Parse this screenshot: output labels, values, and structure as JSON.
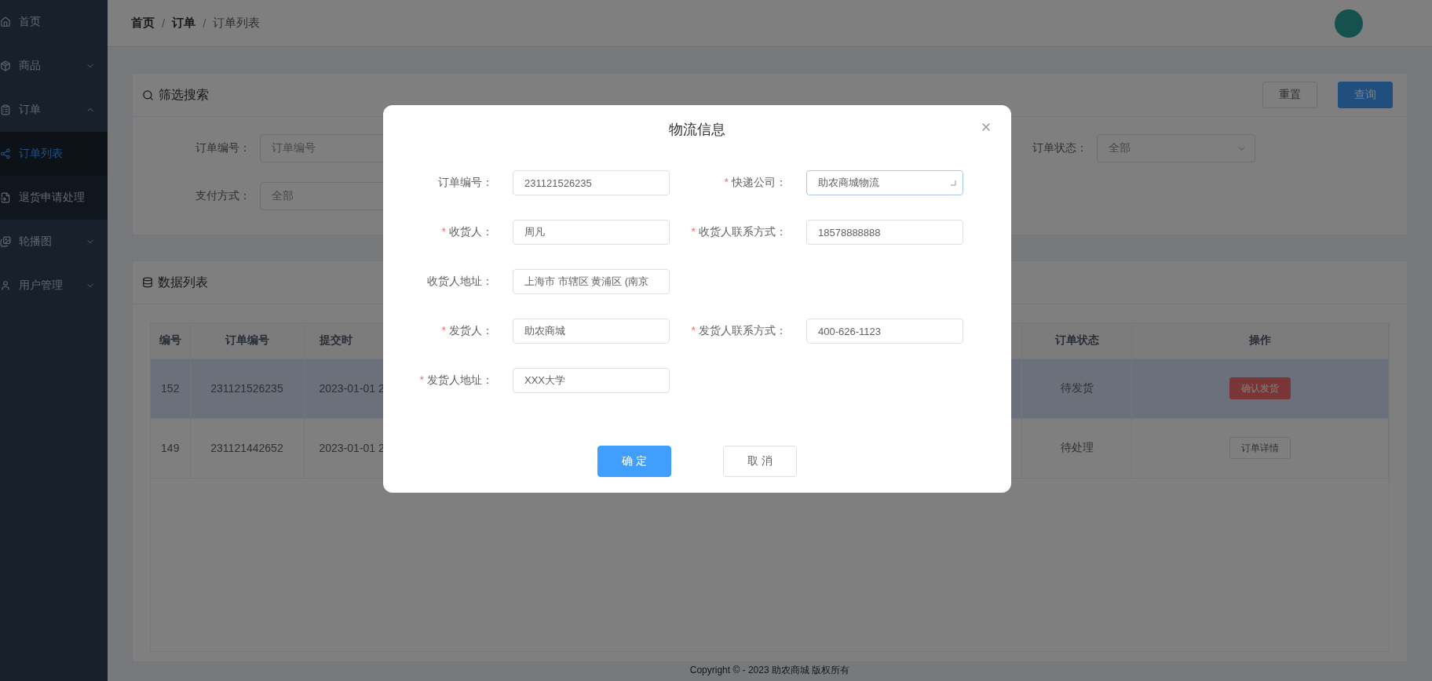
{
  "sidebar": {
    "items": [
      {
        "label": "首页",
        "selected": false
      },
      {
        "label": "商品",
        "selected": false,
        "expanded": false
      },
      {
        "label": "订单",
        "selected": false,
        "expanded": true,
        "children": [
          {
            "label": "订单列表",
            "selected": true
          },
          {
            "label": "退货申请处理",
            "selected": false
          }
        ]
      },
      {
        "label": "轮播图",
        "selected": false,
        "expanded": false
      },
      {
        "label": "用户管理",
        "selected": false,
        "expanded": false
      }
    ]
  },
  "header": {
    "separator": "/",
    "breadcrumb": [
      {
        "label": "首页",
        "current": false
      },
      {
        "label": "订单",
        "current": false
      },
      {
        "label": "订单列表",
        "current": true
      }
    ]
  },
  "filter": {
    "title": "筛选搜索",
    "reset_button": "重置",
    "query_button": "查询",
    "rows": [
      [
        {
          "label": "订单编号：",
          "placeholder": "订单编号",
          "kind": "input"
        },
        {
          "label": "订单状态：",
          "placeholder": "全部",
          "kind": "select"
        }
      ],
      [
        {
          "label": "支付方式：",
          "placeholder": "全部",
          "kind": "input"
        }
      ]
    ]
  },
  "data_list": {
    "title": "数据列表",
    "table": {
      "columns": [
        "编号",
        "订单编号",
        "提交时"
      ],
      "columns_right": [
        "订单状态",
        "操作"
      ],
      "rows": [
        {
          "cells": [
            "152",
            "231121526235",
            "2023-01-01 2"
          ],
          "status": "待发货",
          "action": {
            "label": "确认发货",
            "kind": "danger"
          },
          "selected": true
        },
        {
          "cells": [
            "149",
            "231121442652",
            "2023-01-01 2"
          ],
          "status": "待处理",
          "action": {
            "label": "订单详情",
            "kind": "plain"
          },
          "selected": false
        }
      ]
    }
  },
  "footer": "Copyright © - 2023 助农商城 版权所有",
  "dialog": {
    "title": "物流信息",
    "rows": [
      [
        {
          "label": "订单编号：",
          "value": "231121526235",
          "required": false,
          "kind": "input"
        },
        {
          "label": "快递公司：",
          "value": "助农商城物流",
          "required": true,
          "kind": "select"
        }
      ],
      [
        {
          "label": "收货人：",
          "value": "周凡",
          "required": true,
          "kind": "input"
        },
        {
          "label": "收货人联系方式：",
          "value": "18578888888",
          "required": true,
          "kind": "input"
        }
      ],
      [
        {
          "label": "收货人地址：",
          "value": "上海市 市辖区 黄浦区 (南京",
          "required": false,
          "kind": "input"
        }
      ],
      [
        {
          "label": "发货人：",
          "value": "助农商城",
          "required": true,
          "kind": "input"
        },
        {
          "label": "发货人联系方式：",
          "value": "400-626-1123",
          "required": true,
          "kind": "input"
        }
      ],
      [
        {
          "label": "发货人地址：",
          "value": "XXX大学",
          "required": true,
          "kind": "input"
        }
      ]
    ],
    "required_mark": "*",
    "confirm_button": "确 定",
    "cancel_button": "取 消"
  }
}
